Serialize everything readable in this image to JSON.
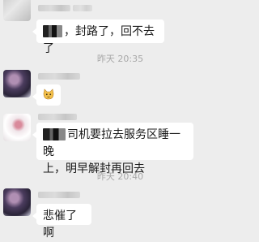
{
  "messages": [
    {
      "nickname": "...夫...",
      "text": "，封路了，回不去了"
    },
    {
      "nickname": "",
      "emoji": "cat-face-emoji"
    },
    {
      "nickname": "",
      "text_line1": "司机要拉去服务区睡一晚",
      "text_line2": "上，明早解封再回去"
    },
    {
      "nickname": "",
      "text": "悲催了啊"
    }
  ],
  "timestamps": [
    "昨天 20:35",
    "昨天 20:40"
  ]
}
